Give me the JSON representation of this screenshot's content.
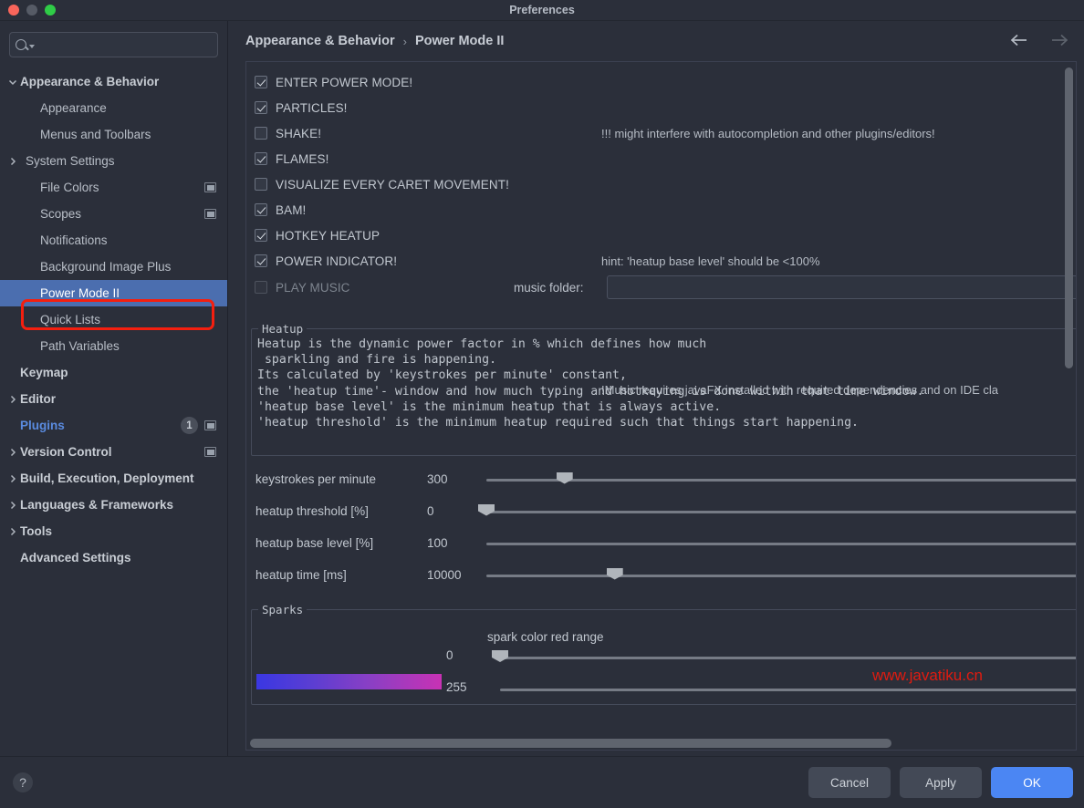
{
  "window": {
    "title": "Preferences",
    "traffic_lights": [
      "close-button",
      "minimize-button",
      "zoom-button"
    ]
  },
  "sidebar": {
    "search": {
      "value": "",
      "placeholder": ""
    },
    "items": [
      {
        "label": "Appearance & Behavior",
        "level": 0,
        "chevron": "down",
        "selected": false
      },
      {
        "label": "Appearance",
        "level": 1,
        "chevron": "none",
        "selected": false
      },
      {
        "label": "Menus and Toolbars",
        "level": 1,
        "chevron": "none",
        "selected": false
      },
      {
        "label": "System Settings",
        "level": 1,
        "chevron": "right",
        "selected": false
      },
      {
        "label": "File Colors",
        "level": 1,
        "chevron": "none",
        "selected": false,
        "scope_icon": true
      },
      {
        "label": "Scopes",
        "level": 1,
        "chevron": "none",
        "selected": false,
        "scope_icon": true
      },
      {
        "label": "Notifications",
        "level": 1,
        "chevron": "none",
        "selected": false
      },
      {
        "label": "Background Image Plus",
        "level": 1,
        "chevron": "none",
        "selected": false
      },
      {
        "label": "Power Mode II",
        "level": 1,
        "chevron": "none",
        "selected": true,
        "highlighted": true
      },
      {
        "label": "Quick Lists",
        "level": 1,
        "chevron": "none",
        "selected": false
      },
      {
        "label": "Path Variables",
        "level": 1,
        "chevron": "none",
        "selected": false
      },
      {
        "label": "Keymap",
        "level": 0,
        "chevron": "none",
        "selected": false
      },
      {
        "label": "Editor",
        "level": 0,
        "chevron": "right",
        "selected": false
      },
      {
        "label": "Plugins",
        "level": 0,
        "chevron": "none",
        "selected": false,
        "accent": true,
        "badge": "1",
        "scope_icon": true
      },
      {
        "label": "Version Control",
        "level": 0,
        "chevron": "right",
        "selected": false,
        "scope_icon": true
      },
      {
        "label": "Build, Execution, Deployment",
        "level": 0,
        "chevron": "right",
        "selected": false
      },
      {
        "label": "Languages & Frameworks",
        "level": 0,
        "chevron": "right",
        "selected": false
      },
      {
        "label": "Tools",
        "level": 0,
        "chevron": "right",
        "selected": false
      },
      {
        "label": "Advanced Settings",
        "level": 0,
        "chevron": "none",
        "selected": false
      }
    ]
  },
  "breadcrumb": {
    "root": "Appearance & Behavior",
    "separator": "›",
    "current": "Power Mode II",
    "back_label": "back-arrow",
    "forward_label": "forward-arrow"
  },
  "main": {
    "checkboxes": [
      {
        "label": "ENTER POWER MODE!",
        "checked": true,
        "disabled": false,
        "hint": ""
      },
      {
        "label": "PARTICLES!",
        "checked": true,
        "disabled": false,
        "hint": ""
      },
      {
        "label": "SHAKE!",
        "checked": false,
        "disabled": false,
        "hint": "!!! might interfere with autocompletion and other plugins/editors!"
      },
      {
        "label": "FLAMES!",
        "checked": true,
        "disabled": false,
        "hint": ""
      },
      {
        "label": "VISUALIZE EVERY CARET MOVEMENT!",
        "checked": false,
        "disabled": false,
        "hint": ""
      },
      {
        "label": "BAM!",
        "checked": true,
        "disabled": false,
        "hint": ""
      },
      {
        "label": "HOTKEY HEATUP",
        "checked": true,
        "disabled": false,
        "hint": ""
      },
      {
        "label": "POWER INDICATOR!",
        "checked": true,
        "disabled": false,
        "hint": "hint: 'heatup base level' should be <100%"
      }
    ],
    "music": {
      "checkbox_label": "PLAY MUSIC",
      "checked": false,
      "disabled": true,
      "folder_label": "music folder:",
      "folder_value": "",
      "folder_placeholder": "",
      "note": "!Music requires javaFX installed with required dependencies and on IDE cla"
    },
    "heatup": {
      "legend": "Heatup",
      "description": "Heatup is the dynamic power factor in % which defines how much\n sparkling and fire is happening.\nIts calculated by 'keystrokes per minute' constant,\nthe 'heatup time'- window and how much typing and hotkeying is done within that time window.\n'heatup base level' is the minimum heatup that is always active.\n'heatup threshold' is the minimum heatup required such that things start happening.",
      "sliders": [
        {
          "name": "keystrokes per minute",
          "value": "300",
          "fraction": 0.095
        },
        {
          "name": "heatup threshold [%]",
          "value": "0",
          "fraction": 0.0
        },
        {
          "name": "heatup base level [%]",
          "value": "100",
          "fraction": -1
        },
        {
          "name": "heatup time [ms]",
          "value": "10000",
          "fraction": 0.156
        }
      ]
    },
    "sparks": {
      "legend": "Sparks",
      "title": "spark color red range",
      "rows": [
        {
          "value": "0",
          "fraction": 0.0
        },
        {
          "value": "255",
          "fraction": -1
        }
      ],
      "gradient_from": "#3a37e2",
      "gradient_to": "#c832b4"
    },
    "watermark": "www.javatiku.cn"
  },
  "footer": {
    "help_label": "?",
    "cancel_label": "Cancel",
    "apply_label": "Apply",
    "ok_label": "OK"
  },
  "colors": {
    "accent": "#4b86f3",
    "selection": "#4b6eaf",
    "highlight_ring": "#f41f0f",
    "background": "#2b2f3a"
  }
}
